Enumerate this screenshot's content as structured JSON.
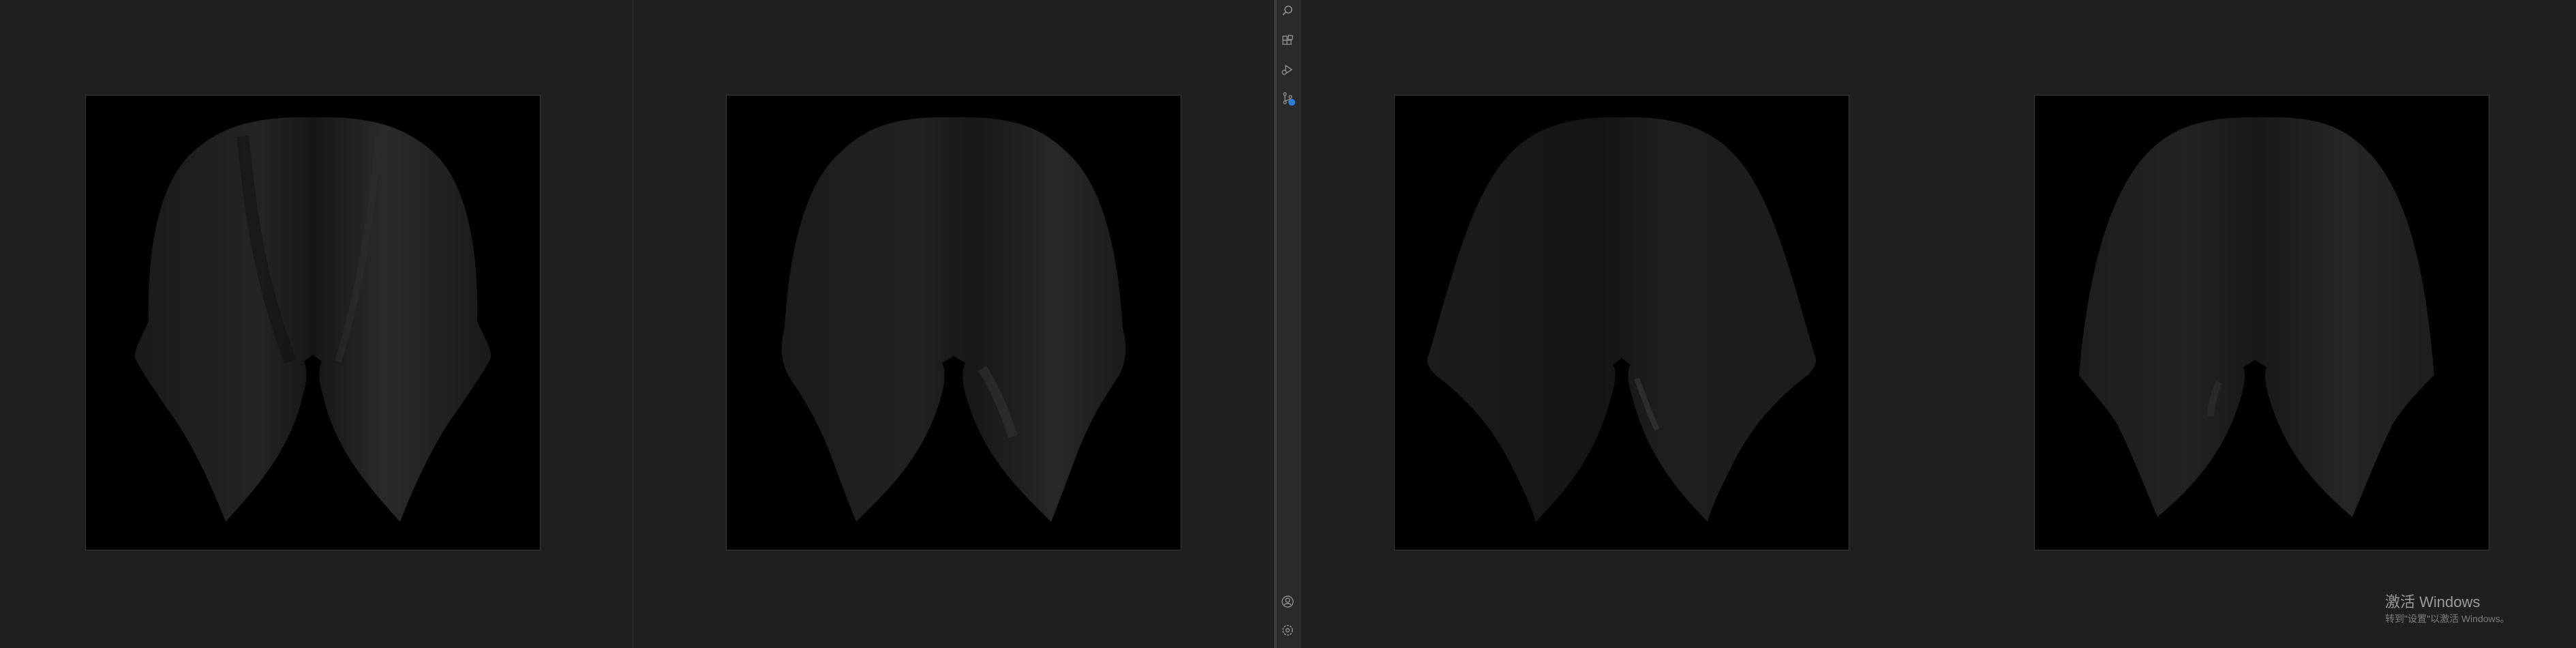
{
  "views": [
    {
      "image": "cape-render-1"
    },
    {
      "image": "cape-render-2"
    },
    {
      "image": "cape-render-3"
    },
    {
      "image": "cape-render-4"
    }
  ],
  "activity_bar": {
    "top_icons": [
      "search-icon",
      "extensions-icon",
      "run-debug-icon",
      "source-control-icon"
    ],
    "bottom_icons": [
      "account-icon",
      "settings-icon"
    ],
    "badge_color": "#2f7fd4"
  },
  "watermark": {
    "title": "激活 Windows",
    "subtitle": "转到\"设置\"以激活 Windows。"
  },
  "colors": {
    "background": "#1f1f1f",
    "viewport": "#000000",
    "activity_bar": "#2a2a2a"
  }
}
